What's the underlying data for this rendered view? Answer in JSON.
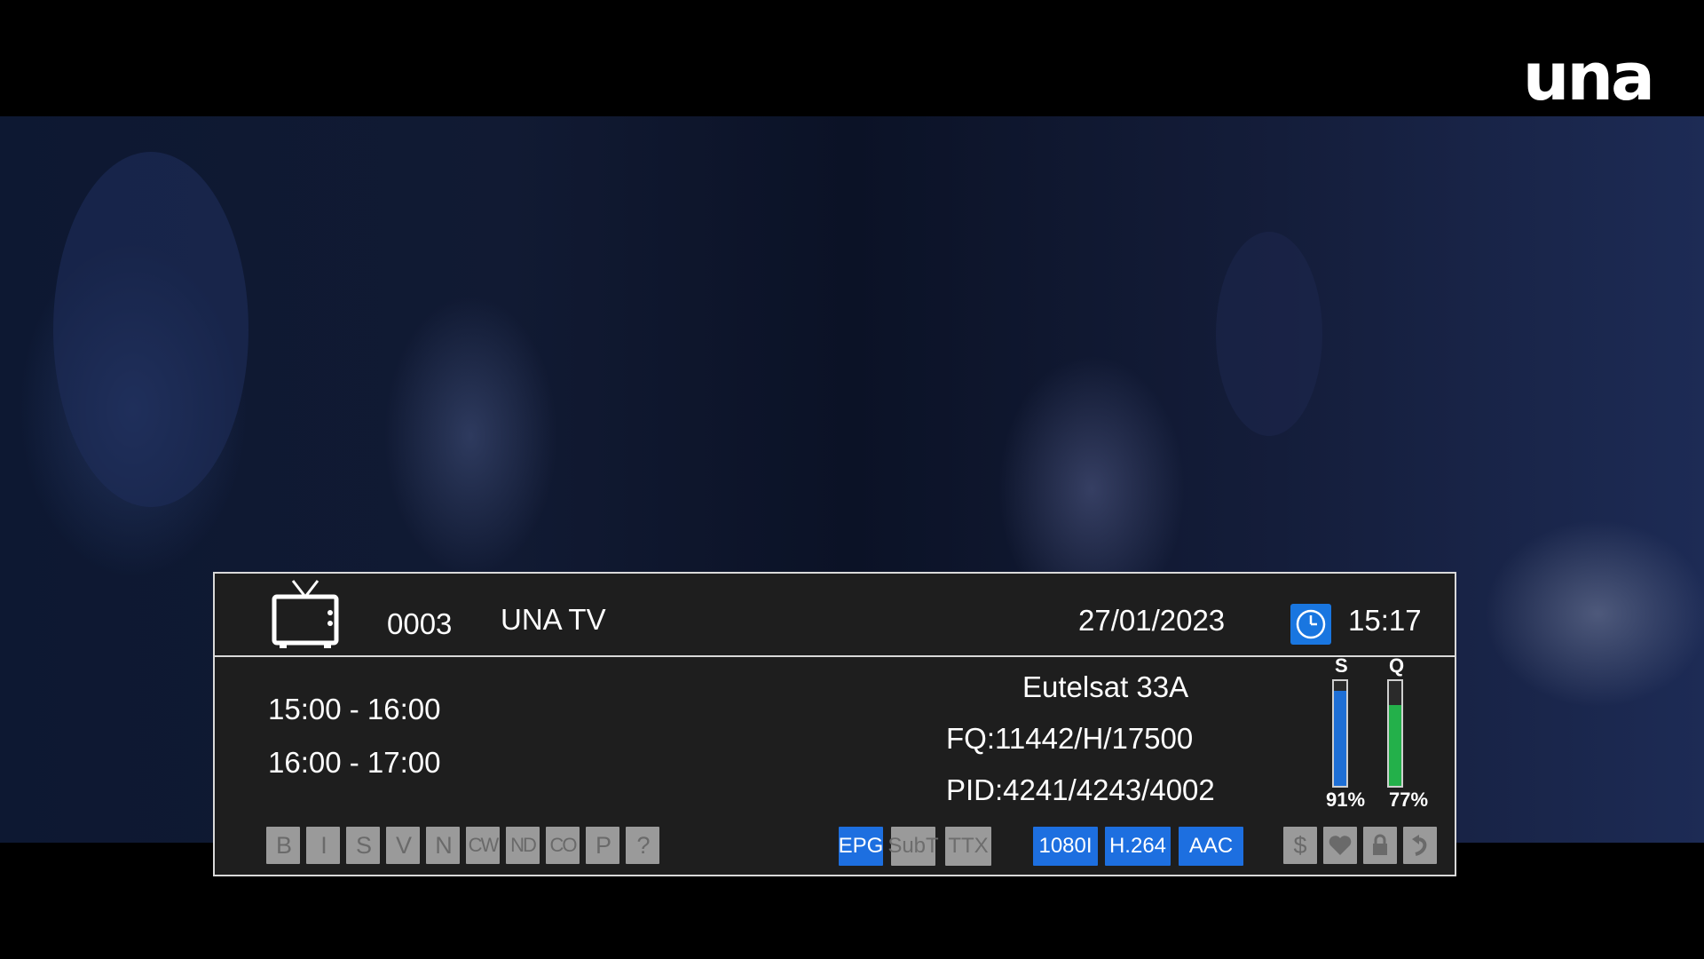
{
  "logo": "una",
  "banner": {
    "channel_number": "0003",
    "channel_name": "UNA TV",
    "date": "27/01/2023",
    "time": "15:17",
    "epg": [
      "15:00 - 16:00",
      "16:00 - 17:00"
    ],
    "satellite": "Eutelsat 33A",
    "frequency": "FQ:11442/H/17500",
    "pid": "PID:4241/4243/4002",
    "signal": {
      "strength_label": "S",
      "strength_value": "91%",
      "strength": 0.91,
      "quality_label": "Q",
      "quality_value": "77%",
      "quality": 0.77
    },
    "flags": [
      "B",
      "I",
      "S",
      "V",
      "N",
      "CW",
      "ND",
      "CO",
      "P",
      "?"
    ],
    "badges": {
      "epg": "EPG",
      "subt": "SubT",
      "ttx": "TTX",
      "resolution": "1080I",
      "video_codec": "H.264",
      "audio_codec": "AAC"
    },
    "status_icons": {
      "pay": "$",
      "favorite": "heart-icon",
      "lock": "lock-icon",
      "skip": "skip-icon"
    },
    "colors": {
      "accent_blue": "#1d6fe0",
      "strength_bar": "#1e6fd6",
      "quality_bar": "#23b04a",
      "inactive_gray": "#9a9a9a"
    }
  }
}
